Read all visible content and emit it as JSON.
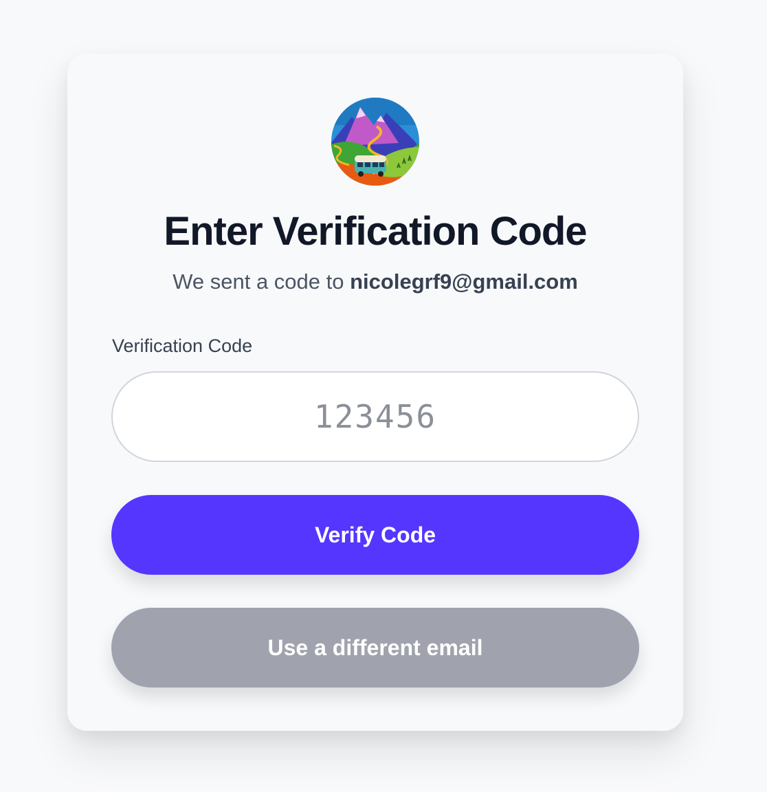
{
  "logo": {
    "icon": "mountain-road-van-illustration",
    "colors": {
      "sky": "#2a8fd6",
      "mountain": "#c05ac8",
      "hills": "#3fa535",
      "road": "#f0b823",
      "ground": "#e85a12"
    }
  },
  "title": "Enter Verification Code",
  "subtitle": {
    "prefix": "We sent a code to ",
    "email": "nicolegrf9@gmail.com"
  },
  "verification_field": {
    "label": "Verification Code",
    "value": "",
    "placeholder": "123456"
  },
  "buttons": {
    "verify_label": "Verify Code",
    "different_email_label": "Use a different email"
  },
  "colors": {
    "primary": "#5436ff",
    "secondary": "#a0a3ad",
    "heading": "#111827",
    "background": "#f8f9fb"
  }
}
